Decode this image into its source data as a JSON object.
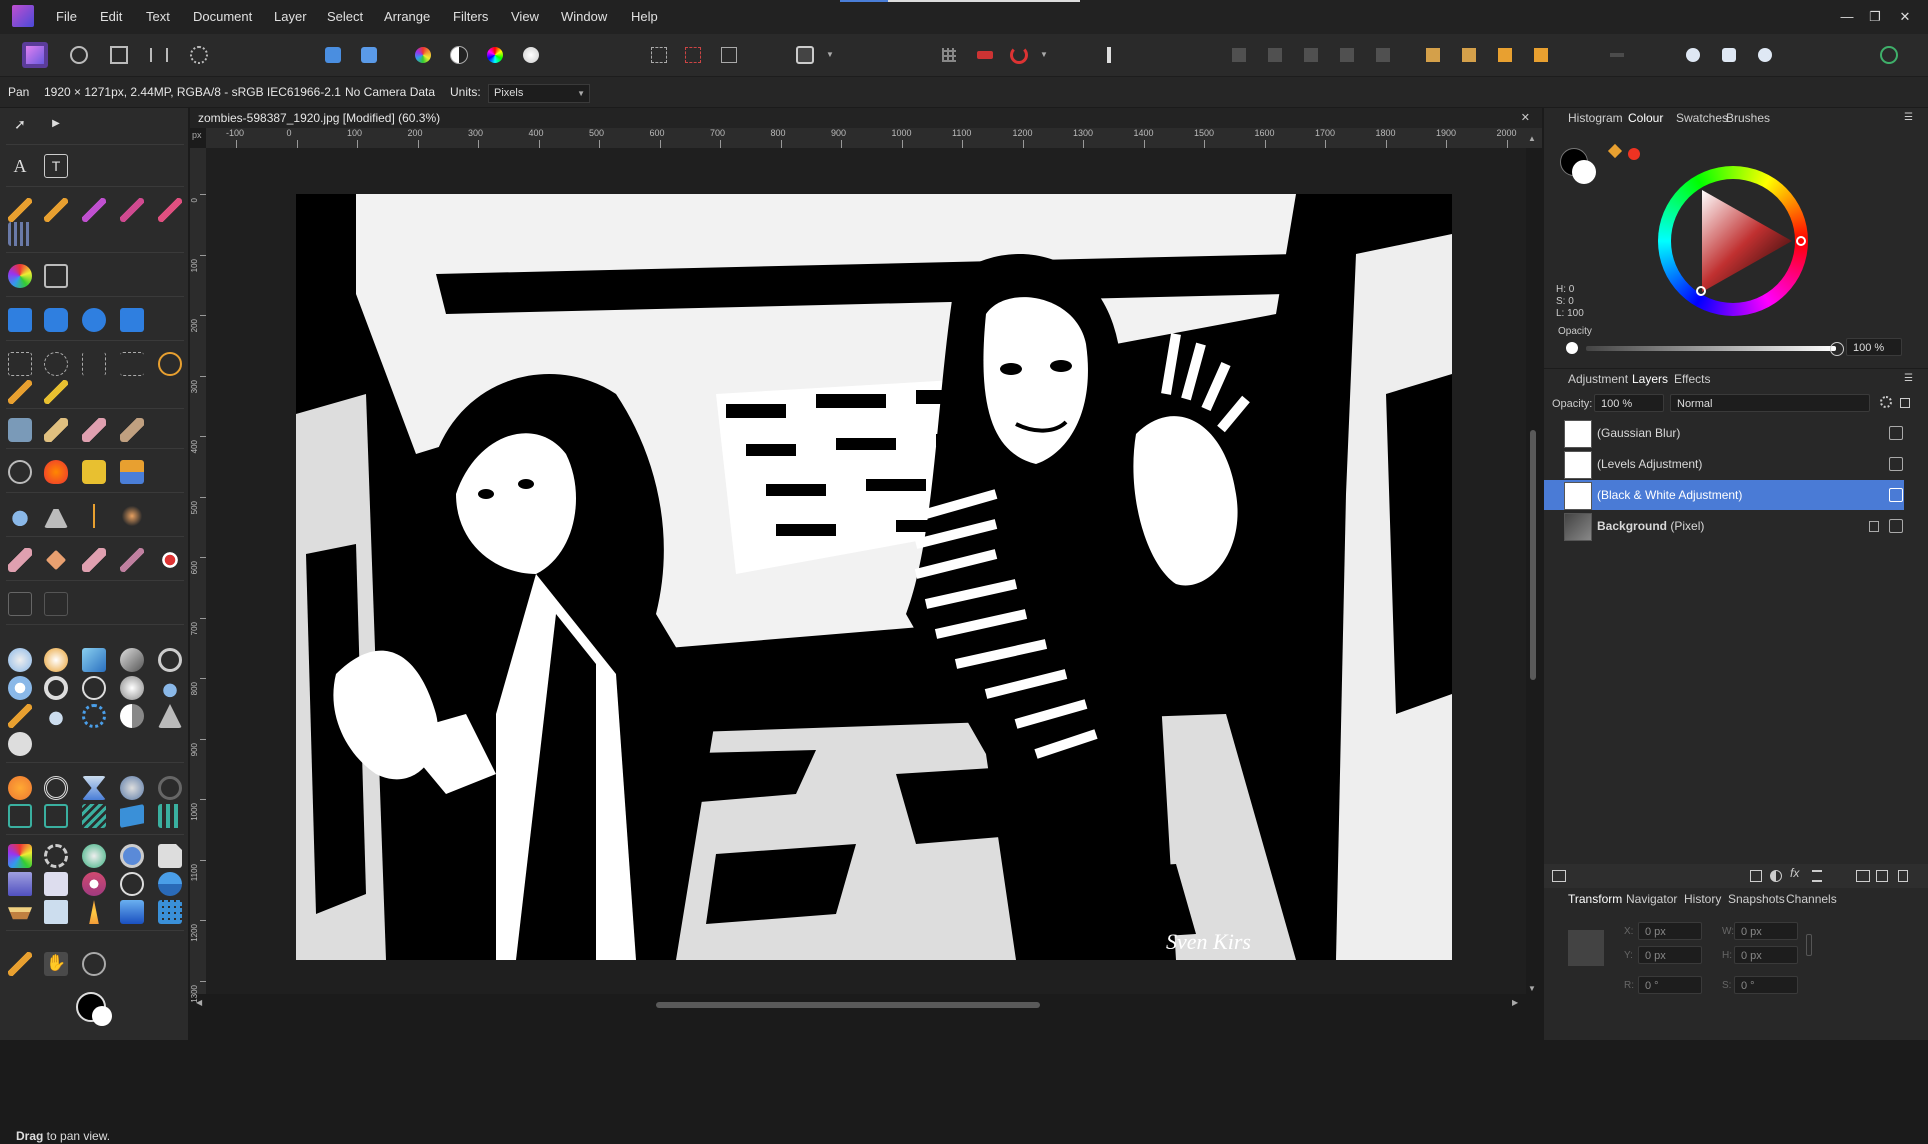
{
  "menubar": {
    "items": [
      "File",
      "Edit",
      "Text",
      "Document",
      "Layer",
      "Select",
      "Arrange",
      "Filters",
      "View",
      "Window",
      "Help"
    ],
    "min": "—",
    "restore": "❐",
    "close": "✕"
  },
  "context": {
    "tool": "Pan",
    "info": "1920 × 1271px, 2.44MP, RGBA/8 - sRGB IEC61966-2.1",
    "camera": "No Camera Data",
    "units_label": "Units:",
    "units_value": "Pixels"
  },
  "document": {
    "tab_title": "zombies-598387_1920.jpg [Modified] (60.3%)",
    "close": "✕",
    "ruler_unit": "px",
    "ruler_h": [
      "-100",
      "0",
      "100",
      "200",
      "300",
      "400",
      "500",
      "600",
      "700",
      "800",
      "900",
      "1000",
      "1100",
      "1200",
      "1300",
      "1400",
      "1500",
      "1600",
      "1700",
      "1800",
      "1900",
      "2000"
    ],
    "ruler_v": [
      "0",
      "100",
      "200",
      "300",
      "400",
      "500",
      "600",
      "700",
      "800",
      "900",
      "1000",
      "1100",
      "1200",
      "1300"
    ],
    "signature": "Sven Kirs"
  },
  "colour_panel": {
    "tabs": [
      "Histogram",
      "Colour",
      "Swatches",
      "Brushes"
    ],
    "active_tab": "Colour",
    "h": "H: 0",
    "s": "S: 0",
    "l": "L: 100",
    "opacity_label": "Opacity",
    "opacity_value": "100 %"
  },
  "layers_panel": {
    "tabs": [
      "Adjustment",
      "Layers",
      "Effects"
    ],
    "active_tab": "Layers",
    "opacity_label": "Opacity:",
    "opacity_value": "100 %",
    "blend_mode": "Normal",
    "layers": [
      {
        "name": "(Gaussian Blur)"
      },
      {
        "name": "(Levels Adjustment)"
      },
      {
        "name": "(Black & White Adjustment)"
      },
      {
        "name_bold": "Background",
        "name_rest": " (Pixel)"
      }
    ]
  },
  "transform_panel": {
    "tabs": [
      "Transform",
      "Navigator",
      "History",
      "Snapshots",
      "Channels"
    ],
    "active_tab": "Transform",
    "labels": [
      "X:",
      "Y:",
      "W:",
      "H:",
      "R:",
      "S:"
    ],
    "x": "0 px",
    "y": "0 px",
    "w": "0 px",
    "h": "0 px",
    "r": "0 °",
    "s": "0 °"
  },
  "hint": {
    "bold": "Drag",
    "rest": " to pan view."
  },
  "colors": {
    "accent": "#4a7ed8",
    "selected_row": "#4a7bd6",
    "brand": "#7f3fbf"
  }
}
